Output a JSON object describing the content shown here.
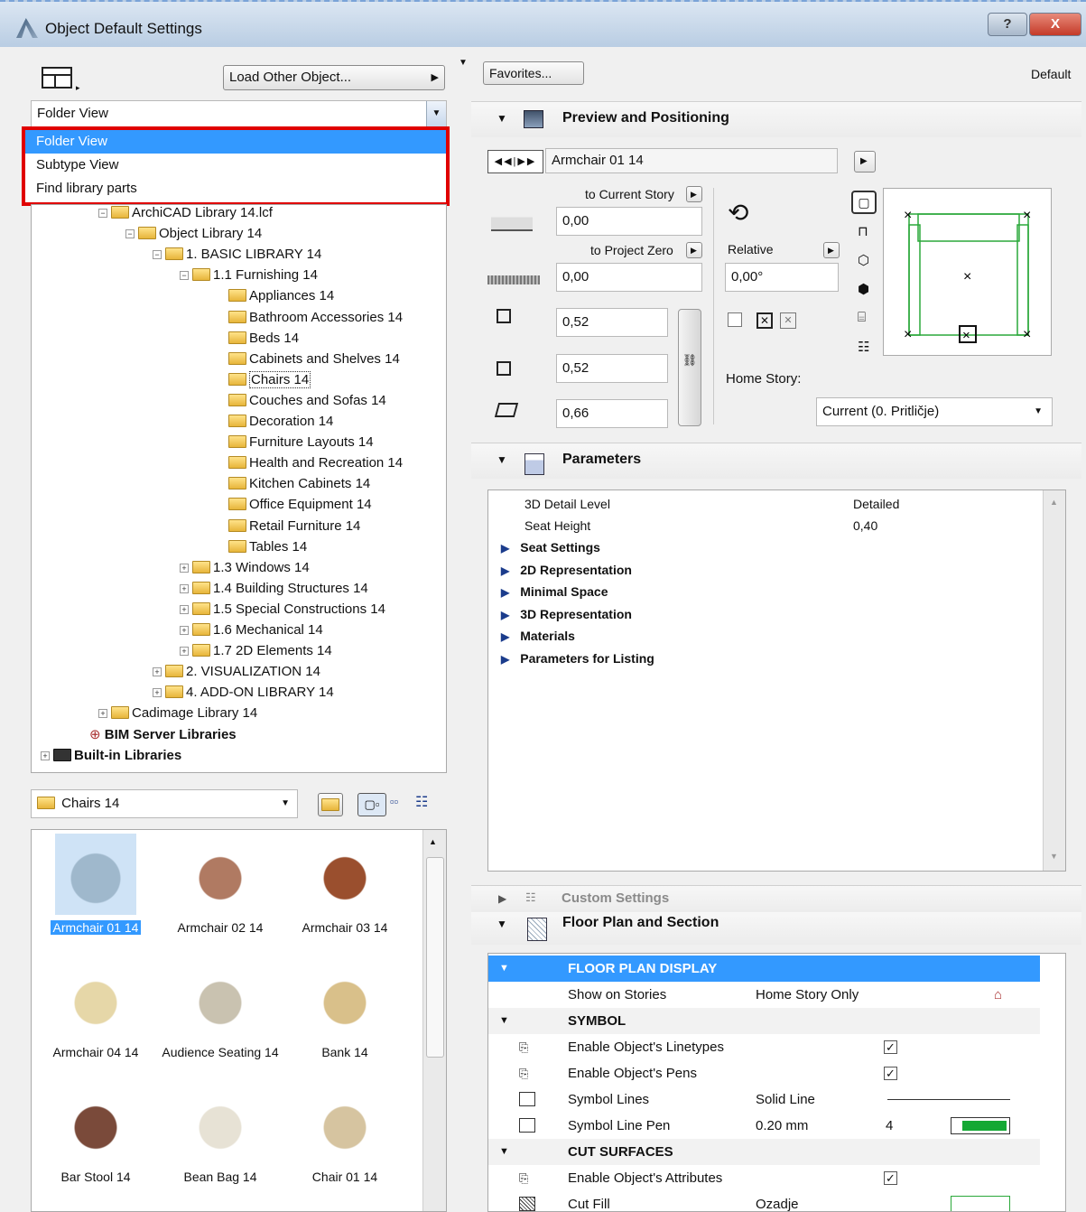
{
  "window": {
    "title": "Object Default Settings",
    "help": "?",
    "close": "X"
  },
  "left": {
    "load_btn": "Load Other Object...",
    "view_select": "Folder View",
    "view_options": [
      "Folder View",
      "Subtype View",
      "Find library parts"
    ],
    "tree": [
      {
        "label": "ArchiCAD Library 14.lcf",
        "pm": "−"
      },
      {
        "label": "Object Library 14",
        "pm": "−"
      },
      {
        "label": "1. BASIC LIBRARY 14",
        "pm": "−"
      },
      {
        "label": "1.1 Furnishing 14",
        "pm": "−"
      },
      {
        "label": "Appliances 14"
      },
      {
        "label": "Bathroom Accessories 14"
      },
      {
        "label": "Beds 14"
      },
      {
        "label": "Cabinets and Shelves 14"
      },
      {
        "label": "Chairs 14"
      },
      {
        "label": "Couches and Sofas 14"
      },
      {
        "label": "Decoration 14"
      },
      {
        "label": "Furniture Layouts 14"
      },
      {
        "label": "Health and Recreation 14"
      },
      {
        "label": "Kitchen Cabinets 14"
      },
      {
        "label": "Office Equipment 14"
      },
      {
        "label": "Retail Furniture 14"
      },
      {
        "label": "Tables 14"
      },
      {
        "label": "1.3 Windows 14",
        "pm": "+"
      },
      {
        "label": "1.4 Building Structures 14",
        "pm": "+"
      },
      {
        "label": "1.5 Special Constructions 14",
        "pm": "+"
      },
      {
        "label": "1.6 Mechanical 14",
        "pm": "+"
      },
      {
        "label": "1.7 2D Elements 14",
        "pm": "+"
      },
      {
        "label": "2. VISUALIZATION 14",
        "pm": "+"
      },
      {
        "label": "4. ADD-ON LIBRARY 14",
        "pm": "+"
      },
      {
        "label": "Cadimage Library 14",
        "pm": "+"
      },
      {
        "label": "BIM Server Libraries"
      },
      {
        "label": "Built-in Libraries",
        "pm": "+"
      }
    ],
    "folder_select": "Chairs 14",
    "gallery": [
      "Armchair 01 14",
      "Armchair 02 14",
      "Armchair 03 14",
      "Armchair 04 14",
      "Audience Seating 14",
      "Bank 14",
      "Bar Stool 14",
      "Bean Bag 14",
      "Chair 01 14"
    ]
  },
  "right": {
    "favorites_btn": "Favorites...",
    "default_label": "Default",
    "preview": {
      "header": "Preview and Positioning",
      "object_name": "Armchair 01 14",
      "to_current_story": "to Current Story",
      "elev_story": "0,00",
      "to_project_zero": "to Project Zero",
      "elev_zero": "0,00",
      "relative": "Relative",
      "angle": "0,00°",
      "width": "0,52",
      "depth": "0,52",
      "height": "0,66",
      "home_story_label": "Home Story:",
      "home_story": "Current (0. Pritličje)"
    },
    "parameters": {
      "header": "Parameters",
      "rows": [
        {
          "name": "3D Detail Level",
          "value": "Detailed"
        },
        {
          "name": "Seat Height",
          "value": "0,40"
        }
      ],
      "groups": [
        "Seat Settings",
        "2D Representation",
        "Minimal Space",
        "3D Representation",
        "Materials",
        "Parameters for Listing"
      ]
    },
    "custom_settings": "Custom Settings",
    "floorplan": {
      "header": "Floor Plan and Section",
      "display_hdr": "FLOOR PLAN DISPLAY",
      "show_on_stories": "Show on Stories",
      "home_story_only": "Home Story Only",
      "symbol_hdr": "SYMBOL",
      "linetypes": "Enable Object's Linetypes",
      "pens": "Enable Object's Pens",
      "symbol_lines": "Symbol Lines",
      "solid_line": "Solid Line",
      "symbol_line_pen": "Symbol Line Pen",
      "pen_size": "0.20 mm",
      "pen_num": "4",
      "cut_hdr": "CUT SURFACES",
      "attributes": "Enable Object's Attributes",
      "cut_fill": "Cut Fill",
      "fill_name": "Ozadje"
    }
  }
}
